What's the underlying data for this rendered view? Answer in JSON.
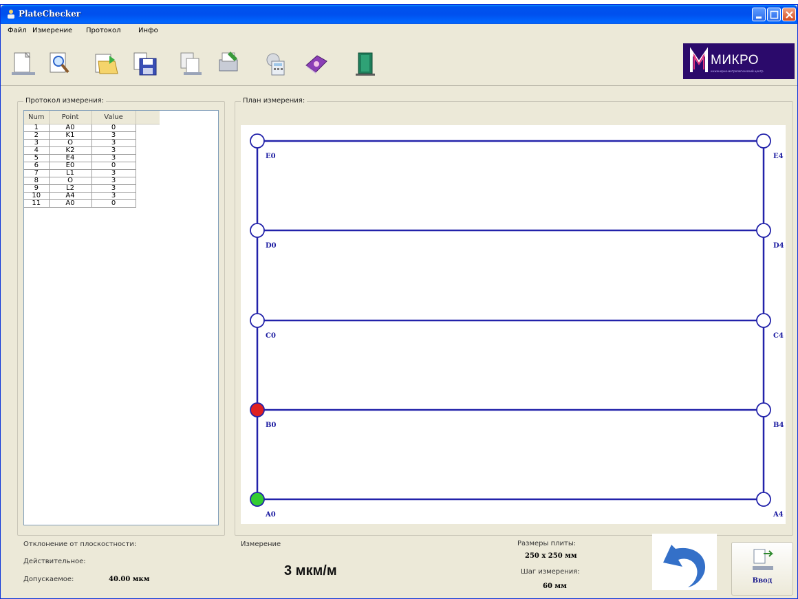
{
  "window": {
    "title": "PlateChecker"
  },
  "menu": [
    "Файл",
    "Измерение",
    "Протокол",
    "Инфо"
  ],
  "toolbar": {
    "icons": [
      "new-document-icon",
      "preview-icon",
      "open-folder-icon",
      "save-disk-icon",
      "copy-icon",
      "print-settings-icon",
      "calculator-icon",
      "help-book-icon",
      "exit-door-icon"
    ]
  },
  "logo": {
    "text": "МИКРО",
    "subtext": "инженерно-метрологический центр"
  },
  "protocol": {
    "label": "Протокол измерения:",
    "columns": [
      "Num",
      "Point",
      "Value"
    ],
    "rows": [
      [
        "1",
        "A0",
        "0"
      ],
      [
        "2",
        "K1",
        "3"
      ],
      [
        "3",
        "O",
        "3"
      ],
      [
        "4",
        "K2",
        "3"
      ],
      [
        "5",
        "E4",
        "3"
      ],
      [
        "6",
        "E0",
        "0"
      ],
      [
        "7",
        "L1",
        "3"
      ],
      [
        "8",
        "O",
        "3"
      ],
      [
        "9",
        "L2",
        "3"
      ],
      [
        "10",
        "A4",
        "3"
      ],
      [
        "11",
        "A0",
        "0"
      ]
    ]
  },
  "plan": {
    "label": "План измерения:",
    "points": [
      "E0",
      "E4",
      "D0",
      "D4",
      "C0",
      "C4",
      "B0",
      "B4",
      "A0",
      "A4"
    ],
    "active_point": "B0",
    "done_point": "A0",
    "colors": {
      "line": "#2222aa",
      "active": "#e02020",
      "done": "#33cc33",
      "node": "#ffffff"
    }
  },
  "deviation": {
    "label": "Отклонение от плоскостности:",
    "actual_label": "Действительное:",
    "allowed_label": "Допускаемое:",
    "allowed_value": "40.00 мкм"
  },
  "measurement": {
    "label": "Измерение",
    "value": "3 мкм/м"
  },
  "plate": {
    "size_label": "Размеры плиты:",
    "size_value": "250 x 250 мм",
    "step_label": "Шаг измерения:",
    "step_value": "60 мм"
  },
  "buttons": {
    "enter_label": "Ввод"
  }
}
